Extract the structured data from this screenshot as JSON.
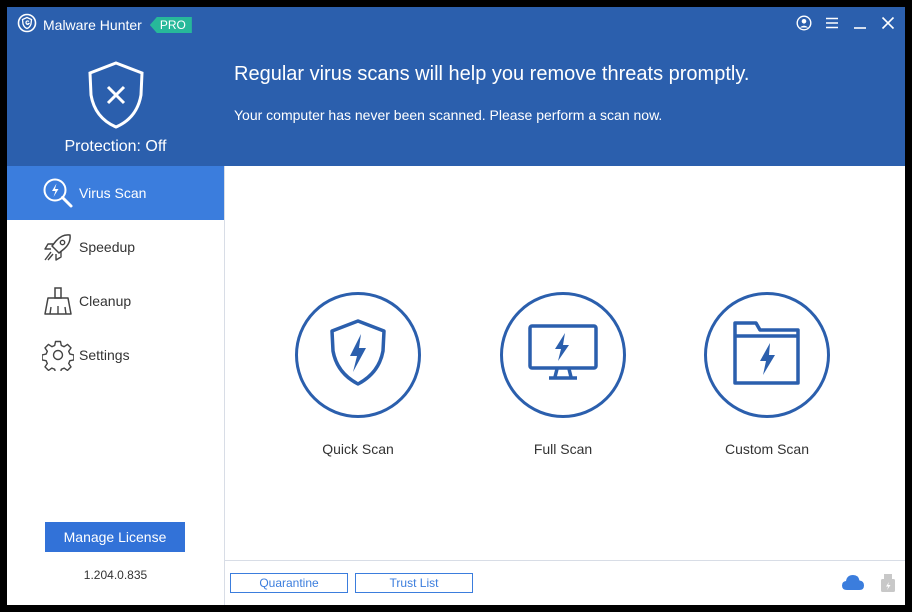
{
  "window": {
    "title": "Malware Hunter",
    "badge": "PRO",
    "controls": [
      "account-icon",
      "menu-icon",
      "minimize-icon",
      "close-icon"
    ]
  },
  "header": {
    "protection_status": "Protection: Off",
    "headline": "Regular virus scans will help you remove threats promptly.",
    "subtext": "Your computer has never been scanned. Please perform a scan now."
  },
  "sidebar": {
    "items": [
      {
        "label": "Virus Scan",
        "icon": "virus-scan-icon",
        "active": true
      },
      {
        "label": "Speedup",
        "icon": "rocket-icon",
        "active": false
      },
      {
        "label": "Cleanup",
        "icon": "broom-icon",
        "active": false
      },
      {
        "label": "Settings",
        "icon": "gear-icon",
        "active": false
      }
    ],
    "license_button": "Manage License",
    "version": "1.204.0.835"
  },
  "main": {
    "scans": [
      {
        "label": "Quick Scan",
        "icon": "shield-bolt-icon"
      },
      {
        "label": "Full Scan",
        "icon": "monitor-bolt-icon"
      },
      {
        "label": "Custom Scan",
        "icon": "folder-bolt-icon"
      }
    ]
  },
  "footer": {
    "quarantine": "Quarantine",
    "trust_list": "Trust List",
    "icons": [
      "cloud-icon",
      "usb-icon"
    ]
  },
  "colors": {
    "header_bg": "#2b5fad",
    "active_nav": "#3b7ddd",
    "button": "#3272d8",
    "pro_badge": "#27b89a"
  }
}
